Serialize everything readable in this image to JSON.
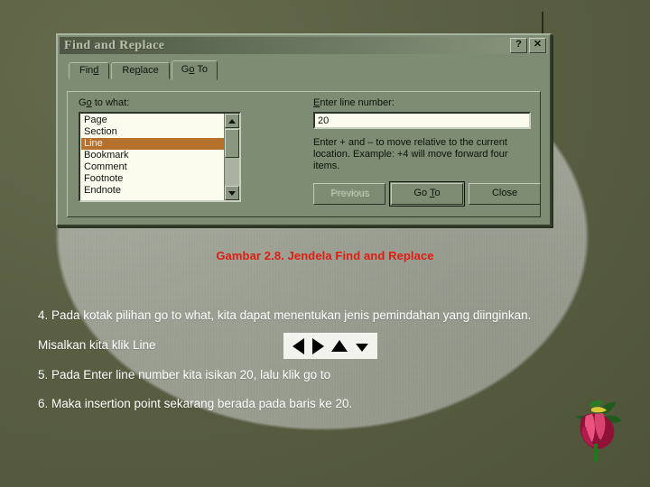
{
  "dialog": {
    "title": "Find and Replace",
    "titlebar_buttons": [
      {
        "name": "help-button",
        "glyph": "?"
      },
      {
        "name": "close-button",
        "glyph": "✕"
      }
    ],
    "tabs": [
      {
        "label": "Find",
        "accel": "d",
        "active": false
      },
      {
        "label": "Replace",
        "accel": "p",
        "active": false
      },
      {
        "label": "Go To",
        "accel": "o",
        "active": true
      }
    ],
    "goto_what_label": "Go to what:",
    "goto_what_options": [
      "Page",
      "Section",
      "Line",
      "Bookmark",
      "Comment",
      "Footnote",
      "Endnote"
    ],
    "goto_what_selected": "Line",
    "enter_number_label": "Enter line number:",
    "enter_number_value": "20",
    "enter_number_placeholder": "",
    "help_text": "Enter + and – to move relative to the current location. Example: +4 will move forward four items.",
    "buttons": [
      {
        "label": "Previous",
        "state": "disabled"
      },
      {
        "label": "Go To",
        "state": "default"
      },
      {
        "label": "Close",
        "state": "normal"
      }
    ],
    "scrollbar": {
      "up_icon": "triangle-up-icon",
      "down_icon": "triangle-down-icon"
    }
  },
  "page": {
    "caption": "Gambar 2.8. Jendela Find and Replace",
    "paragraphs": [
      "4. Pada kotak pilihan go to what, kita dapat menentukan jenis pemindahan yang diinginkan.",
      "Misalkan kita klik Line",
      "5. Pada Enter line number kita isikan 20, lalu klik go to",
      "6. Maka insertion point sekarang berada pada baris ke 20."
    ],
    "nav_arrows": [
      "arrow-left-icon",
      "arrow-right-icon",
      "arrow-up-icon",
      "arrow-down-icon"
    ],
    "decoration": "flower-illustration"
  },
  "colors": {
    "background": "#5a5f43",
    "paper": "#9fa395",
    "dialog_face": "#7d8c73",
    "selection": "#b5702c",
    "caption_red": "#e01b10",
    "field_white": "#fbfbee"
  }
}
